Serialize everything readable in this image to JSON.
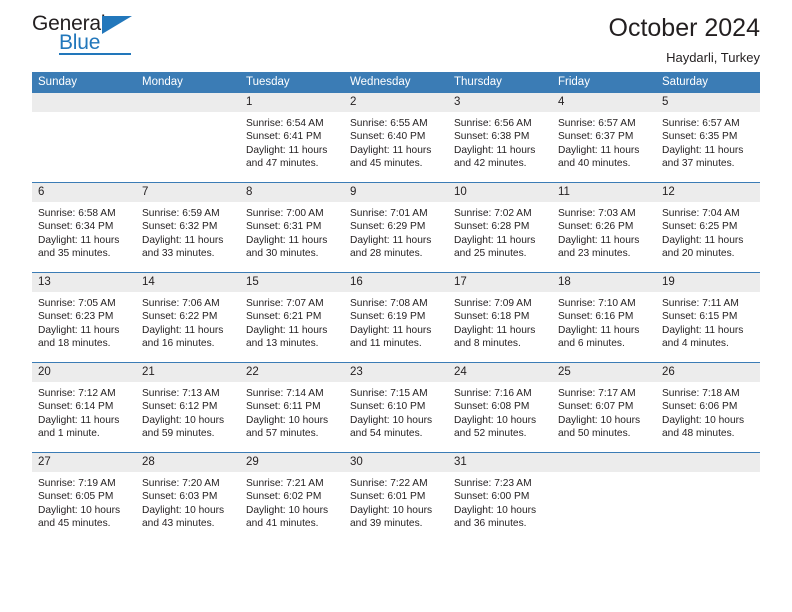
{
  "brand": {
    "name_part1": "General",
    "name_part2": "Blue",
    "logo_icon": "triangle-icon",
    "accent_color": "#2277bb"
  },
  "header": {
    "title": "October 2024",
    "location": "Haydarli, Turkey"
  },
  "theme": {
    "header_bar_color": "#3b7cb5",
    "daynum_band_color": "#ececec",
    "divider_color": "#3b7cb5",
    "text_color": "#231f20"
  },
  "labels": {
    "sunrise_prefix": "Sunrise:",
    "sunset_prefix": "Sunset:",
    "daylight_prefix": "Daylight:"
  },
  "weekdays": [
    "Sunday",
    "Monday",
    "Tuesday",
    "Wednesday",
    "Thursday",
    "Friday",
    "Saturday"
  ],
  "weeks": [
    [
      {
        "day": "",
        "sunrise": "",
        "sunset": "",
        "daylight_line1": "",
        "daylight_line2": ""
      },
      {
        "day": "",
        "sunrise": "",
        "sunset": "",
        "daylight_line1": "",
        "daylight_line2": ""
      },
      {
        "day": "1",
        "sunrise": "Sunrise: 6:54 AM",
        "sunset": "Sunset: 6:41 PM",
        "daylight_line1": "Daylight: 11 hours",
        "daylight_line2": "and 47 minutes."
      },
      {
        "day": "2",
        "sunrise": "Sunrise: 6:55 AM",
        "sunset": "Sunset: 6:40 PM",
        "daylight_line1": "Daylight: 11 hours",
        "daylight_line2": "and 45 minutes."
      },
      {
        "day": "3",
        "sunrise": "Sunrise: 6:56 AM",
        "sunset": "Sunset: 6:38 PM",
        "daylight_line1": "Daylight: 11 hours",
        "daylight_line2": "and 42 minutes."
      },
      {
        "day": "4",
        "sunrise": "Sunrise: 6:57 AM",
        "sunset": "Sunset: 6:37 PM",
        "daylight_line1": "Daylight: 11 hours",
        "daylight_line2": "and 40 minutes."
      },
      {
        "day": "5",
        "sunrise": "Sunrise: 6:57 AM",
        "sunset": "Sunset: 6:35 PM",
        "daylight_line1": "Daylight: 11 hours",
        "daylight_line2": "and 37 minutes."
      }
    ],
    [
      {
        "day": "6",
        "sunrise": "Sunrise: 6:58 AM",
        "sunset": "Sunset: 6:34 PM",
        "daylight_line1": "Daylight: 11 hours",
        "daylight_line2": "and 35 minutes."
      },
      {
        "day": "7",
        "sunrise": "Sunrise: 6:59 AM",
        "sunset": "Sunset: 6:32 PM",
        "daylight_line1": "Daylight: 11 hours",
        "daylight_line2": "and 33 minutes."
      },
      {
        "day": "8",
        "sunrise": "Sunrise: 7:00 AM",
        "sunset": "Sunset: 6:31 PM",
        "daylight_line1": "Daylight: 11 hours",
        "daylight_line2": "and 30 minutes."
      },
      {
        "day": "9",
        "sunrise": "Sunrise: 7:01 AM",
        "sunset": "Sunset: 6:29 PM",
        "daylight_line1": "Daylight: 11 hours",
        "daylight_line2": "and 28 minutes."
      },
      {
        "day": "10",
        "sunrise": "Sunrise: 7:02 AM",
        "sunset": "Sunset: 6:28 PM",
        "daylight_line1": "Daylight: 11 hours",
        "daylight_line2": "and 25 minutes."
      },
      {
        "day": "11",
        "sunrise": "Sunrise: 7:03 AM",
        "sunset": "Sunset: 6:26 PM",
        "daylight_line1": "Daylight: 11 hours",
        "daylight_line2": "and 23 minutes."
      },
      {
        "day": "12",
        "sunrise": "Sunrise: 7:04 AM",
        "sunset": "Sunset: 6:25 PM",
        "daylight_line1": "Daylight: 11 hours",
        "daylight_line2": "and 20 minutes."
      }
    ],
    [
      {
        "day": "13",
        "sunrise": "Sunrise: 7:05 AM",
        "sunset": "Sunset: 6:23 PM",
        "daylight_line1": "Daylight: 11 hours",
        "daylight_line2": "and 18 minutes."
      },
      {
        "day": "14",
        "sunrise": "Sunrise: 7:06 AM",
        "sunset": "Sunset: 6:22 PM",
        "daylight_line1": "Daylight: 11 hours",
        "daylight_line2": "and 16 minutes."
      },
      {
        "day": "15",
        "sunrise": "Sunrise: 7:07 AM",
        "sunset": "Sunset: 6:21 PM",
        "daylight_line1": "Daylight: 11 hours",
        "daylight_line2": "and 13 minutes."
      },
      {
        "day": "16",
        "sunrise": "Sunrise: 7:08 AM",
        "sunset": "Sunset: 6:19 PM",
        "daylight_line1": "Daylight: 11 hours",
        "daylight_line2": "and 11 minutes."
      },
      {
        "day": "17",
        "sunrise": "Sunrise: 7:09 AM",
        "sunset": "Sunset: 6:18 PM",
        "daylight_line1": "Daylight: 11 hours",
        "daylight_line2": "and 8 minutes."
      },
      {
        "day": "18",
        "sunrise": "Sunrise: 7:10 AM",
        "sunset": "Sunset: 6:16 PM",
        "daylight_line1": "Daylight: 11 hours",
        "daylight_line2": "and 6 minutes."
      },
      {
        "day": "19",
        "sunrise": "Sunrise: 7:11 AM",
        "sunset": "Sunset: 6:15 PM",
        "daylight_line1": "Daylight: 11 hours",
        "daylight_line2": "and 4 minutes."
      }
    ],
    [
      {
        "day": "20",
        "sunrise": "Sunrise: 7:12 AM",
        "sunset": "Sunset: 6:14 PM",
        "daylight_line1": "Daylight: 11 hours",
        "daylight_line2": "and 1 minute."
      },
      {
        "day": "21",
        "sunrise": "Sunrise: 7:13 AM",
        "sunset": "Sunset: 6:12 PM",
        "daylight_line1": "Daylight: 10 hours",
        "daylight_line2": "and 59 minutes."
      },
      {
        "day": "22",
        "sunrise": "Sunrise: 7:14 AM",
        "sunset": "Sunset: 6:11 PM",
        "daylight_line1": "Daylight: 10 hours",
        "daylight_line2": "and 57 minutes."
      },
      {
        "day": "23",
        "sunrise": "Sunrise: 7:15 AM",
        "sunset": "Sunset: 6:10 PM",
        "daylight_line1": "Daylight: 10 hours",
        "daylight_line2": "and 54 minutes."
      },
      {
        "day": "24",
        "sunrise": "Sunrise: 7:16 AM",
        "sunset": "Sunset: 6:08 PM",
        "daylight_line1": "Daylight: 10 hours",
        "daylight_line2": "and 52 minutes."
      },
      {
        "day": "25",
        "sunrise": "Sunrise: 7:17 AM",
        "sunset": "Sunset: 6:07 PM",
        "daylight_line1": "Daylight: 10 hours",
        "daylight_line2": "and 50 minutes."
      },
      {
        "day": "26",
        "sunrise": "Sunrise: 7:18 AM",
        "sunset": "Sunset: 6:06 PM",
        "daylight_line1": "Daylight: 10 hours",
        "daylight_line2": "and 48 minutes."
      }
    ],
    [
      {
        "day": "27",
        "sunrise": "Sunrise: 7:19 AM",
        "sunset": "Sunset: 6:05 PM",
        "daylight_line1": "Daylight: 10 hours",
        "daylight_line2": "and 45 minutes."
      },
      {
        "day": "28",
        "sunrise": "Sunrise: 7:20 AM",
        "sunset": "Sunset: 6:03 PM",
        "daylight_line1": "Daylight: 10 hours",
        "daylight_line2": "and 43 minutes."
      },
      {
        "day": "29",
        "sunrise": "Sunrise: 7:21 AM",
        "sunset": "Sunset: 6:02 PM",
        "daylight_line1": "Daylight: 10 hours",
        "daylight_line2": "and 41 minutes."
      },
      {
        "day": "30",
        "sunrise": "Sunrise: 7:22 AM",
        "sunset": "Sunset: 6:01 PM",
        "daylight_line1": "Daylight: 10 hours",
        "daylight_line2": "and 39 minutes."
      },
      {
        "day": "31",
        "sunrise": "Sunrise: 7:23 AM",
        "sunset": "Sunset: 6:00 PM",
        "daylight_line1": "Daylight: 10 hours",
        "daylight_line2": "and 36 minutes."
      },
      {
        "day": "",
        "sunrise": "",
        "sunset": "",
        "daylight_line1": "",
        "daylight_line2": ""
      },
      {
        "day": "",
        "sunrise": "",
        "sunset": "",
        "daylight_line1": "",
        "daylight_line2": ""
      }
    ]
  ]
}
